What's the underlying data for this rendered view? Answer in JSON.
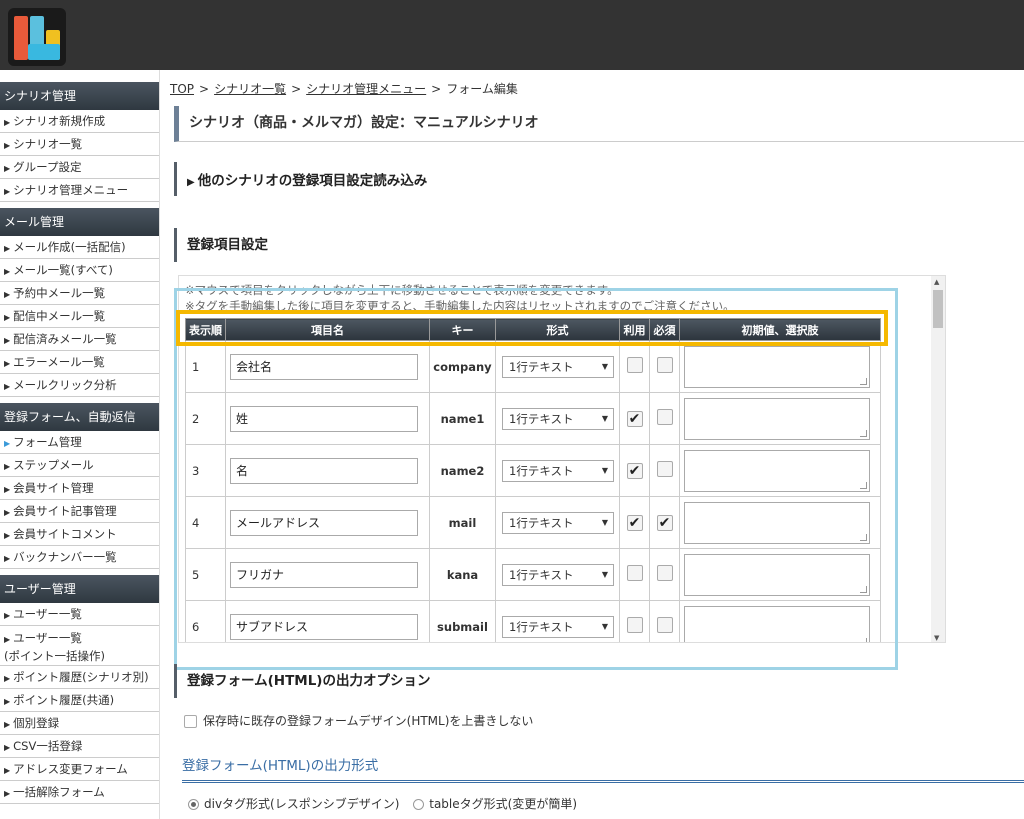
{
  "sidebar": {
    "groups": [
      {
        "title": "シナリオ管理",
        "items": [
          "シナリオ新規作成",
          "シナリオ一覧",
          "グループ設定",
          "シナリオ管理メニュー"
        ]
      },
      {
        "title": "メール管理",
        "items": [
          "メール作成(一括配信)",
          "メール一覧(すべて)",
          "予約中メール一覧",
          "配信中メール一覧",
          "配信済みメール一覧",
          "エラーメール一覧",
          "メールクリック分析"
        ]
      },
      {
        "title": "登録フォーム、自動返信",
        "items": [
          "フォーム管理",
          "ステップメール",
          "会員サイト管理",
          "会員サイト記事管理",
          "会員サイトコメント",
          "バックナンバー一覧"
        ]
      },
      {
        "title": "ユーザー管理",
        "items": [
          "ユーザー一覧",
          "ユーザー一覧",
          "(ポイント一括操作)",
          "ポイント履歴(シナリオ別)",
          "ポイント履歴(共通)",
          "個別登録",
          "CSV一括登録",
          "アドレス変更フォーム",
          "一括解除フォーム"
        ]
      }
    ],
    "active": "フォーム管理"
  },
  "breadcrumb": {
    "items": [
      "TOP",
      "シナリオ一覧",
      "シナリオ管理メニュー"
    ],
    "current": "フォーム編集",
    "sep": ">"
  },
  "page_title": "シナリオ（商品・メルマガ）設定：マニュアルシナリオ",
  "section_load": "他のシナリオの登録項目設定読み込み",
  "section_fields": "登録項目設定",
  "notes": [
    "※マウスで項目をクリックしながら上下に移動させることで表示順を変更できます。",
    "※タグを手動編集した後に項目を変更すると、手動編集した内容はリセットされますのでご注意ください。"
  ],
  "table": {
    "headers": [
      "表示順",
      "項目名",
      "キー",
      "形式",
      "利用",
      "必須",
      "初期値、選択肢"
    ],
    "rows": [
      {
        "order": "1",
        "name": "会社名",
        "key": "company",
        "format": "1行テキスト",
        "use": false,
        "required": false
      },
      {
        "order": "2",
        "name": "姓",
        "key": "name1",
        "format": "1行テキスト",
        "use": true,
        "required": false
      },
      {
        "order": "3",
        "name": "名",
        "key": "name2",
        "format": "1行テキスト",
        "use": true,
        "required": false
      },
      {
        "order": "4",
        "name": "メールアドレス",
        "key": "mail",
        "format": "1行テキスト",
        "use": true,
        "required": true
      },
      {
        "order": "5",
        "name": "フリガナ",
        "key": "kana",
        "format": "1行テキスト",
        "use": false,
        "required": false
      },
      {
        "order": "6",
        "name": "サブアドレス",
        "key": "submail",
        "format": "1行テキスト",
        "use": false,
        "required": false
      }
    ]
  },
  "section_html_options": "登録フォーム(HTML)の出力オプション",
  "overwrite_option": "保存時に既存の登録フォームデザイン(HTML)を上書きしない",
  "output_format_title": "登録フォーム(HTML)の出力形式",
  "radio_div": "divタグ形式(レスポンシブデザイン)",
  "radio_table": "tableタグ形式(変更が簡単)",
  "colors": {
    "highlight_yellow": "#f5b800",
    "highlight_blue": "#9ed3e6",
    "header_dark": "#333333",
    "accent_link": "#3a6ea5"
  }
}
